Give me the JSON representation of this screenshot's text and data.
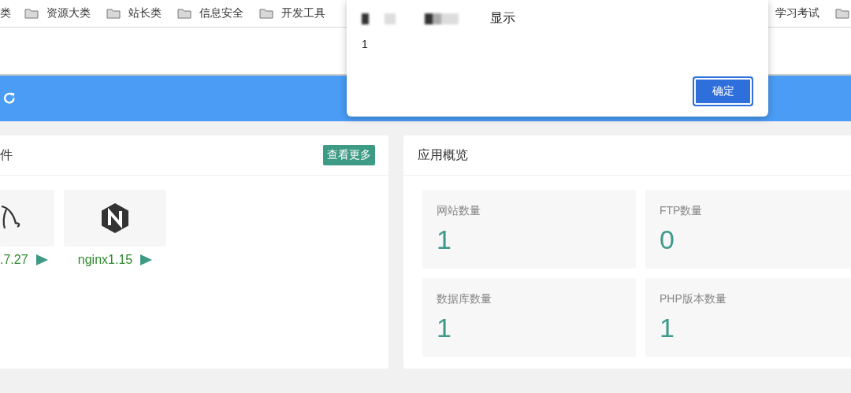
{
  "bookmarks": [
    {
      "label": "类",
      "folder": false
    },
    {
      "label": "资源大类",
      "folder": true
    },
    {
      "label": "站长类",
      "folder": true
    },
    {
      "label": "信息安全",
      "folder": true
    },
    {
      "label": "开发工具",
      "folder": true
    },
    {
      "label": "学习考试",
      "folder": false
    }
  ],
  "software_panel": {
    "title": "件",
    "more_button": "查看更多",
    "items": [
      {
        "kind": "dolphin",
        "label": ".7.27"
      },
      {
        "kind": "nginx",
        "label": "nginx1.15"
      }
    ]
  },
  "overview_panel": {
    "title": "应用概览",
    "stats": [
      {
        "label": "网站数量",
        "value": "1"
      },
      {
        "label": "FTP数量",
        "value": "0"
      },
      {
        "label": "数据库数量",
        "value": "1"
      },
      {
        "label": "PHP版本数量",
        "value": "1"
      }
    ]
  },
  "dialog": {
    "title": "显示",
    "message": "1",
    "button": "确定"
  }
}
